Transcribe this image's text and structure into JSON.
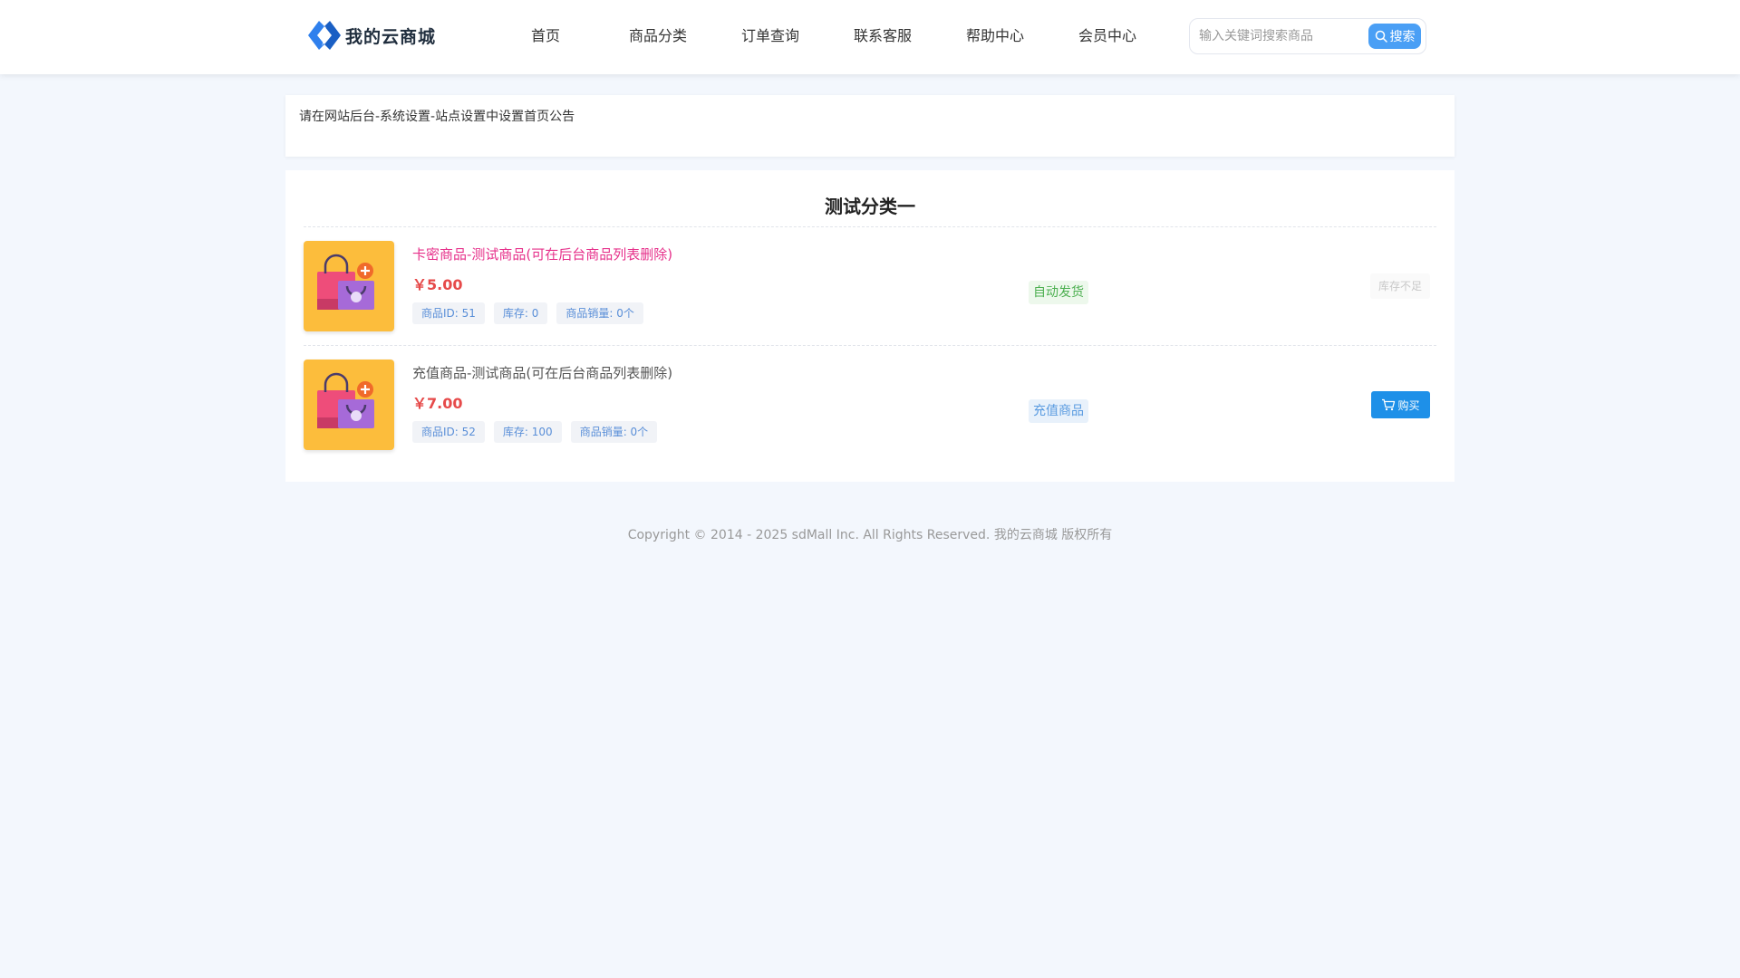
{
  "brand": {
    "name": "我的云商城"
  },
  "nav": {
    "items": [
      {
        "label": "首页"
      },
      {
        "label": "商品分类"
      },
      {
        "label": "订单查询"
      },
      {
        "label": "联系客服"
      },
      {
        "label": "帮助中心"
      },
      {
        "label": "会员中心"
      }
    ]
  },
  "search": {
    "placeholder": "输入关键词搜索商品",
    "value": "",
    "button_label": "搜索",
    "icon": "search-icon"
  },
  "notice": {
    "text": "请在网站后台-系统设置-站点设置中设置首页公告"
  },
  "category": {
    "title": "测试分类一",
    "products": [
      {
        "name": "卡密商品-测试商品(可在后台商品列表删除)",
        "price": "￥5.00",
        "id_tag": "商品ID: 51",
        "stock_tag": "库存: 0",
        "sales_tag": "商品销量: 0个",
        "delivery": "自动发货",
        "action": "库存不足",
        "action_enabled": false,
        "thumb_icon": "shopping-bag-icon"
      },
      {
        "name": "充值商品-测试商品(可在后台商品列表删除)",
        "price": "￥7.00",
        "id_tag": "商品ID: 52",
        "stock_tag": "库存: 100",
        "sales_tag": "商品销量: 0个",
        "delivery": "充值商品",
        "action": "购买",
        "action_enabled": true,
        "thumb_icon": "shopping-bag-icon",
        "action_icon": "cart-icon"
      }
    ]
  },
  "footer": {
    "copyright": "Copyright © 2014 - 2025 sdMall Inc. All Rights Reserved. 我的云商城 版权所有"
  },
  "colors": {
    "accent": "#1e90e8",
    "search_button": "#4a9ff5",
    "price": "#e64a4a",
    "highlight_name": "#e6308a",
    "auto_delivery": "#4caf50",
    "page_bg": "#f3f7fd"
  }
}
